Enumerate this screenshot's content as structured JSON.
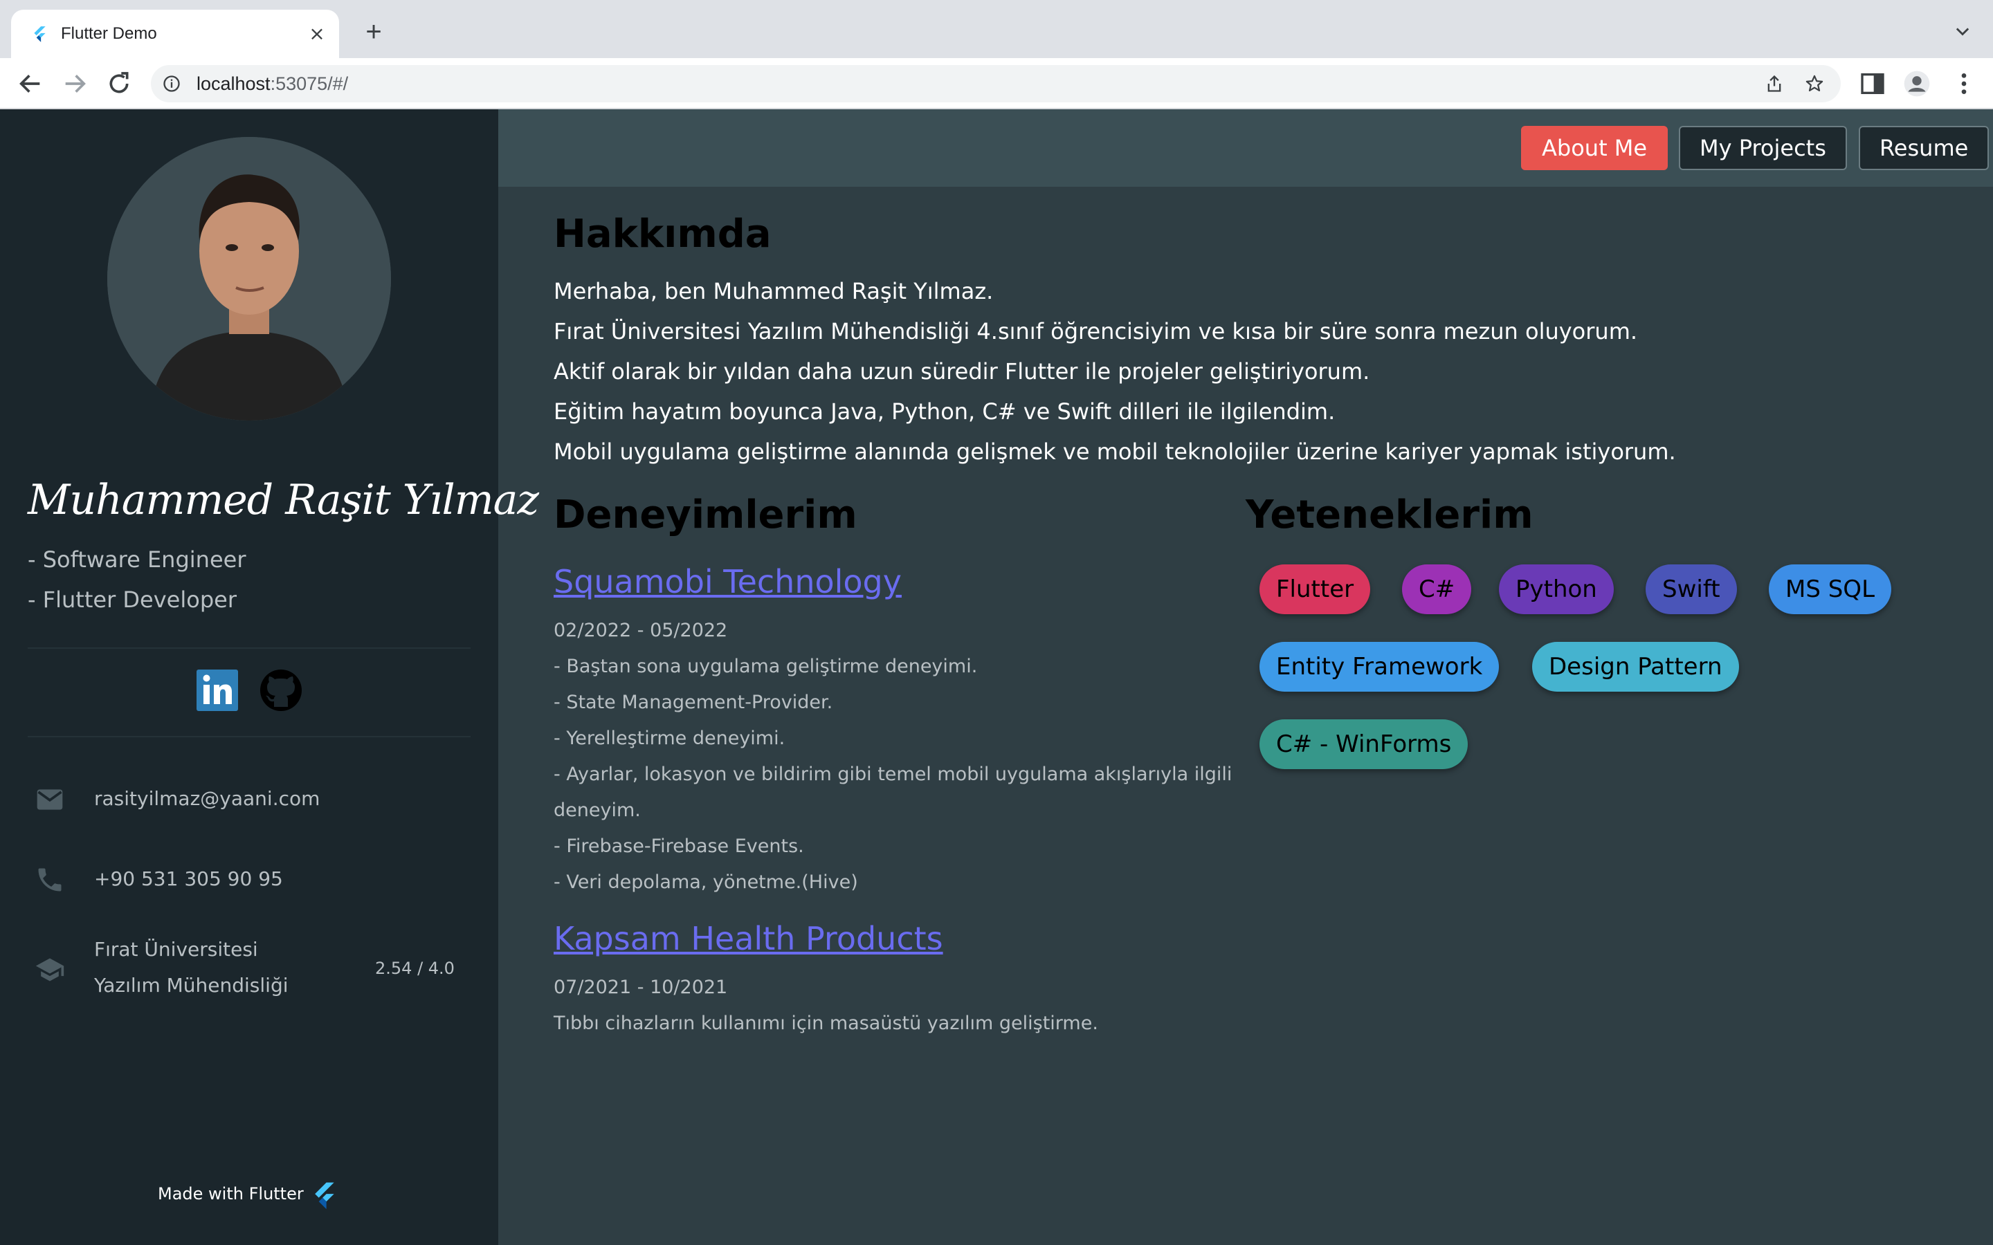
{
  "browser": {
    "tab_title": "Flutter Demo",
    "url_host": "localhost",
    "url_rest": ":53075/#/"
  },
  "sidebar": {
    "name": "Muhammed Raşit Yılmaz",
    "roles": [
      "- Software Engineer",
      "- Flutter Developer"
    ],
    "social": [
      {
        "icon": "linkedin-icon",
        "label": "in"
      },
      {
        "icon": "github-icon"
      }
    ],
    "email": "rasityilmaz@yaani.com",
    "phone": "+90 531 305 90 95",
    "education": {
      "school": "Fırat Üniversitesi",
      "department": "Yazılım Mühendisliği",
      "gpa": "2.54 / 4.0"
    },
    "made_with": "Made with Flutter"
  },
  "nav": {
    "about": "About Me",
    "projects": "My Projects",
    "resume": "Resume",
    "active_color": "#e8544e"
  },
  "about": {
    "heading": "Hakkımda",
    "lines": [
      "Merhaba, ben Muhammed Raşit Yılmaz.",
      "Fırat Üniversitesi Yazılım Mühendisliği 4.sınıf öğrencisiyim ve kısa bir süre sonra mezun oluyorum.",
      "Aktif olarak bir yıldan daha uzun süredir Flutter ile projeler geliştiriyorum.",
      "Eğitim hayatım boyunca Java, Python, C# ve Swift dilleri ile ilgilendim.",
      "Mobil uygulama geliştirme alanında gelişmek ve mobil teknolojiler üzerine kariyer yapmak istiyorum."
    ]
  },
  "experience": {
    "heading": "Deneyimlerim",
    "items": [
      {
        "company": "Squamobi Technology",
        "dates": "02/2022 - 05/2022",
        "lines": [
          "- Baştan sona uygulama geliştirme deneyimi.",
          "- State Management-Provider.",
          "- Yerelleştirme deneyimi.",
          "- Ayarlar, lokasyon ve bildirim gibi temel mobil uygulama akışlarıyla ilgili",
          "deneyim.",
          "- Firebase-Firebase Events.",
          "- Veri depolama, yönetme.(Hive)"
        ]
      },
      {
        "company": "Kapsam Health Products",
        "dates": "07/2021 - 10/2021",
        "lines": [
          "Tıbbı cihazların kullanımı için masaüstü yazılım geliştirme."
        ]
      }
    ]
  },
  "skills": {
    "heading": "Yeteneklerim",
    "items": [
      {
        "label": "Flutter",
        "color": "#d9365e"
      },
      {
        "label": "C#",
        "color": "#9c31b5"
      },
      {
        "label": "Python",
        "color": "#6a3ab6"
      },
      {
        "label": "Swift",
        "color": "#4a55b8"
      },
      {
        "label": "MS SQL",
        "color": "#3d8ee6"
      },
      {
        "label": "Entity Framework",
        "color": "#3d9ae8"
      },
      {
        "label": "Design Pattern",
        "color": "#45b3cf"
      },
      {
        "label": "C# - WinForms",
        "color": "#36978a"
      }
    ]
  }
}
